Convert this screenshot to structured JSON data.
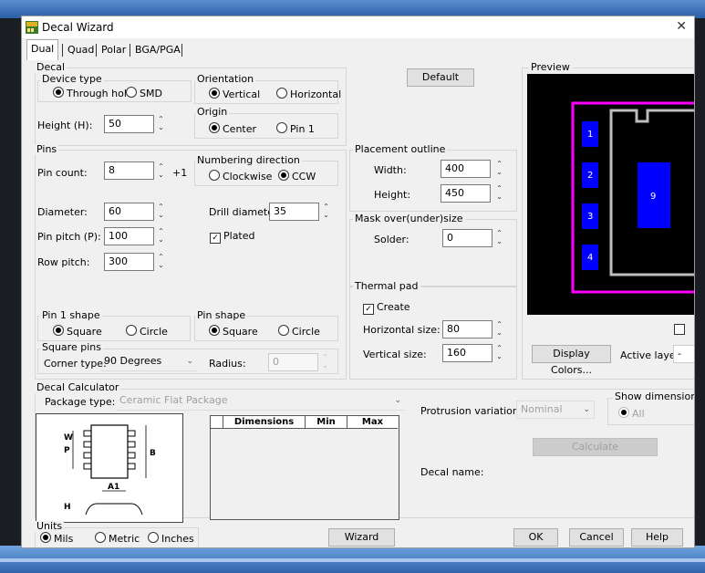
{
  "window": {
    "title": "Decal Wizard"
  },
  "tabs": [
    "Dual",
    "Quad",
    "Polar",
    "BGA/PGA"
  ],
  "decal": {
    "label": "Decal",
    "device_type": {
      "label": "Device type",
      "through_hole": "Through hole",
      "smd": "SMD",
      "selected": "Through hole"
    },
    "orientation": {
      "label": "Orientation",
      "vertical": "Vertical",
      "horizontal": "Horizontal",
      "selected": "Vertical"
    },
    "origin": {
      "label": "Origin",
      "center": "Center",
      "pin1": "Pin 1",
      "selected": "Center"
    },
    "height_label": "Height (H):",
    "height_value": "50"
  },
  "default_button": "Default",
  "pins": {
    "label": "Pins",
    "pin_count_label": "Pin count:",
    "pin_count_value": "8",
    "pin_count_step": "+1",
    "numbering": {
      "label": "Numbering direction",
      "clockwise": "Clockwise",
      "ccw": "CCW",
      "selected": "CCW"
    },
    "diameter_label": "Diameter:",
    "diameter_value": "60",
    "drill_label": "Drill diameter:",
    "drill_value": "35",
    "pitch_label": "Pin pitch (P):",
    "pitch_value": "100",
    "plated_label": "Plated",
    "plated_checked": true,
    "row_pitch_label": "Row pitch:",
    "row_pitch_value": "300",
    "pin1_shape": {
      "label": "Pin 1 shape",
      "square": "Square",
      "circle": "Circle",
      "selected": "Square"
    },
    "pin_shape": {
      "label": "Pin shape",
      "square": "Square",
      "circle": "Circle",
      "selected": "Square"
    },
    "square_pins": {
      "label": "Square pins",
      "corner_label": "Corner type:",
      "corner_value": "90 Degrees",
      "radius_label": "Radius:",
      "radius_value": "0"
    }
  },
  "placement_outline": {
    "label": "Placement outline",
    "width_label": "Width:",
    "width_value": "400",
    "height_label": "Height:",
    "height_value": "450"
  },
  "mask": {
    "label": "Mask over(under)size",
    "solder_label": "Solder:",
    "solder_value": "0"
  },
  "thermal_pad": {
    "label": "Thermal pad",
    "create_label": "Create",
    "create_checked": true,
    "hsize_label": "Horizontal size:",
    "hsize_value": "80",
    "vsize_label": "Vertical size:",
    "vsize_value": "160"
  },
  "preview": {
    "label": "Preview",
    "pins": [
      "1",
      "2",
      "3",
      "4"
    ],
    "thermal_pad_label": "9",
    "colors": {
      "pad": "#0000ff",
      "outline": "#ff00ff",
      "body": "#bdbdbd"
    }
  },
  "preview_controls": {
    "display_colors": "Display Colors...",
    "active_layer_label": "Active layer:"
  },
  "calculator": {
    "label": "Decal Calculator",
    "package_type_label": "Package type:",
    "package_type_value": "Ceramic Flat Package",
    "table_headers": [
      "Dimensions",
      "Min",
      "Max"
    ],
    "diagram_labels": [
      "W",
      "P",
      "B",
      "A1",
      "H"
    ],
    "protrusion_label": "Protrusion variation:",
    "protrusion_value": "Nominal",
    "show_dimension_label": "Show dimension",
    "show_dimension_all": "All",
    "calculate_button": "Calculate",
    "decal_name_label": "Decal name:"
  },
  "units": {
    "label": "Units",
    "mils": "Mils",
    "metric": "Metric",
    "inches": "Inches",
    "selected": "Mils"
  },
  "buttons": {
    "wizard_options": "Wizard Options...",
    "ok": "OK",
    "cancel": "Cancel",
    "help": "Help"
  }
}
